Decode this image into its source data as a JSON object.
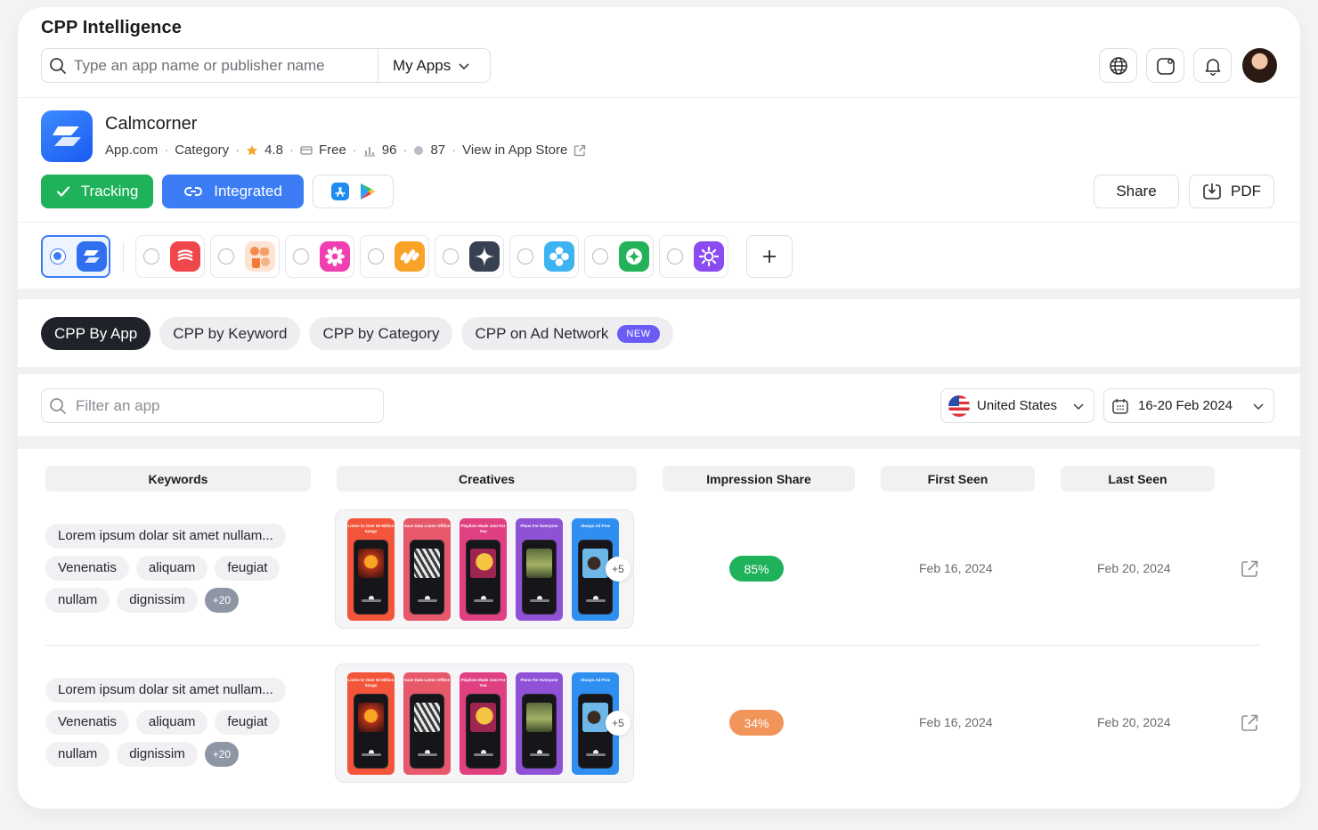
{
  "header": {
    "brand": "CPP Intelligence",
    "search_placeholder": "Type an app name or publisher name",
    "scope_label": "My Apps"
  },
  "app": {
    "name": "Calmcorner",
    "publisher": "App.com",
    "category": "Category",
    "rating": "4.8",
    "price": "Free",
    "rank": "96",
    "score": "87",
    "store_link": "View in App Store",
    "tracking_label": "Tracking",
    "integrated_label": "Integrated",
    "share_label": "Share",
    "pdf_label": "PDF"
  },
  "competitors": [
    {
      "name": "calmcorner",
      "selected": true,
      "color": "#2f6ff0"
    },
    {
      "name": "comp-red-waves",
      "selected": false,
      "color": "#f0474c"
    },
    {
      "name": "comp-orange-shapes",
      "selected": false,
      "color": "#f6a77b"
    },
    {
      "name": "comp-pink-flower",
      "selected": false,
      "color": "#f03fb0"
    },
    {
      "name": "comp-orange-grid",
      "selected": false,
      "color": "#f8a227"
    },
    {
      "name": "comp-dark-star",
      "selected": false,
      "color": "#384151"
    },
    {
      "name": "comp-blue-dots",
      "selected": false,
      "color": "#3db4f2"
    },
    {
      "name": "comp-green-circle",
      "selected": false,
      "color": "#23b25a"
    },
    {
      "name": "comp-purple-sun",
      "selected": false,
      "color": "#8a4cf0"
    }
  ],
  "tabs": [
    {
      "label": "CPP By App",
      "active": true
    },
    {
      "label": "CPP by Keyword",
      "active": false
    },
    {
      "label": "CPP by Category",
      "active": false
    },
    {
      "label": "CPP on Ad Network",
      "active": false,
      "badge": "NEW"
    }
  ],
  "filters": {
    "filter_placeholder": "Filter an app",
    "country": "United States",
    "date_range": "16-20 Feb 2024"
  },
  "table": {
    "columns": [
      "Keywords",
      "Creatives",
      "Impression Share",
      "First Seen",
      "Last Seen"
    ],
    "creative_captions": [
      "Listen to Over 50 Million Songs",
      "Save Data Listen Offline",
      "Playlists Made Just For You",
      "Plans For Everyone",
      "Always Ad Free"
    ],
    "creative_colors": [
      "#f2553a",
      "#e6586a",
      "#e03f82",
      "#8f52d6",
      "#2f8ff0"
    ],
    "rows": [
      {
        "keywords": [
          "Lorem ipsum dolar sit amet nullam...",
          "Venenatis",
          "aliquam",
          "feugiat",
          "nullam",
          "dignissim"
        ],
        "more_keywords": "+20",
        "more_creatives": "+5",
        "impression_share": "85%",
        "share_color": "#1fb25a",
        "first_seen": "Feb 16, 2024",
        "last_seen": "Feb 20, 2024"
      },
      {
        "keywords": [
          "Lorem ipsum dolar sit amet nullam...",
          "Venenatis",
          "aliquam",
          "feugiat",
          "nullam",
          "dignissim"
        ],
        "more_keywords": "+20",
        "more_creatives": "+5",
        "impression_share": "34%",
        "share_color": "#f2955a",
        "first_seen": "Feb 16, 2024",
        "last_seen": "Feb 20, 2024"
      }
    ]
  }
}
